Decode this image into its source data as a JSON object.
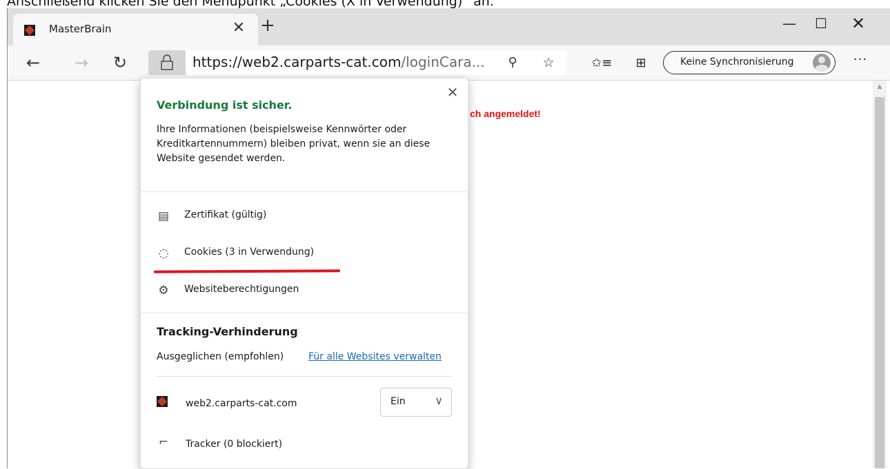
{
  "caption": "Anschließend klicken Sie den Menüpunkt „Cookies (X in Verwendung)“ an.",
  "tab": {
    "title": "MasterBrain",
    "close": "✕",
    "new_tab": "+"
  },
  "window": {
    "minimize": "—",
    "maximize": "☐",
    "close": "✕"
  },
  "toolbar": {
    "back": "←",
    "forward": "→",
    "reload": "↻",
    "url_host": "https://web2.carparts-cat.com",
    "url_path": "/loginCara...",
    "key_icon": "⚲",
    "star_icon": "☆",
    "favorites_icon": "✩≡",
    "collections_icon": "⊞",
    "sync_label": "Keine Synchronisierung",
    "more": "···"
  },
  "page": {
    "message": "ch angemeldet!"
  },
  "popup": {
    "close": "✕",
    "title": "Verbindung ist sicher.",
    "description": "Ihre Informationen (beispielsweise Kennwörter oder Kreditkartennummern) bleiben privat, wenn sie an diese Website gesendet werden.",
    "menu": [
      {
        "icon": "certificate-icon",
        "glyph": "▤",
        "label": "Zertifikat (gültig)"
      },
      {
        "icon": "cookie-icon",
        "glyph": "◌",
        "label": "Cookies (3 in Verwendung)"
      },
      {
        "icon": "gear-icon",
        "glyph": "⚙",
        "label": "Websiteberechtigungen"
      }
    ],
    "tracking": {
      "title": "Tracking-Verhinderung",
      "mode": "Ausgeglichen (empfohlen)",
      "manage_link": "Für alle Websites verwalten",
      "site": "web2.carparts-cat.com",
      "select_value": "Ein",
      "select_chevron": "∨",
      "tracker_glyph": "⌐",
      "tracker_label": "Tracker (0 blockiert)"
    }
  },
  "colors": {
    "secure": "#157b3a",
    "link": "#1668c0",
    "alert": "#e8110f",
    "highlight": "#e0141f"
  }
}
